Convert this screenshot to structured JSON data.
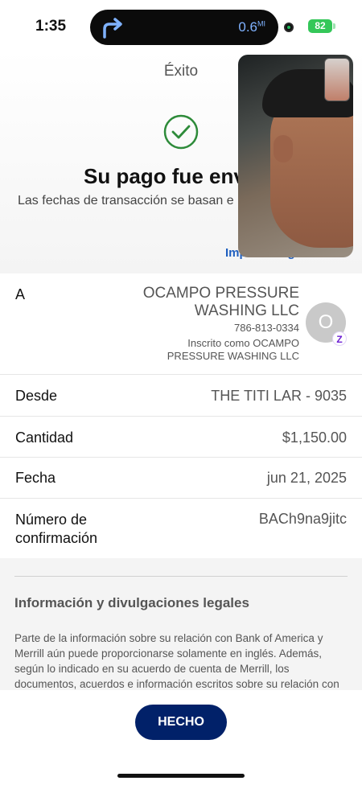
{
  "status_bar": {
    "time": "1:35",
    "nav_distance": "0.6",
    "nav_unit": "MI",
    "battery": "82"
  },
  "header": {
    "title": "Éxito",
    "success_title": "Su pago fue env",
    "success_subtitle": "Las fechas de transacción se basan e",
    "print_link": "Imprimir o guardar"
  },
  "recipient": {
    "label": "A",
    "name": "OCAMPO PRESSURE WASHING LLC",
    "phone": "786-813-0334",
    "registered_as": "Inscrito como OCAMPO PRESSURE WASHING LLC",
    "avatar_initial": "O",
    "badge": "Z"
  },
  "details": [
    {
      "label": "Desde",
      "value": "THE TITI LAR - 9035"
    },
    {
      "label": "Cantidad",
      "value": "$1,150.00"
    },
    {
      "label": "Fecha",
      "value": "jun 21, 2025"
    },
    {
      "label": "Número de confirmación",
      "value": "BACh9na9jitc"
    }
  ],
  "legal": {
    "title": "Información y divulgaciones legales",
    "text": "Parte de la información sobre su relación con Bank of America y Merrill aún puede proporcionarse solamente en inglés. Además, según lo indicado en su acuerdo de cuenta de Merrill, los documentos, acuerdos e información escritos sobre su relación con Merrill, que incluyen pero no se limitan a productos"
  },
  "footer": {
    "done_label": "HECHO"
  },
  "colors": {
    "primary_button": "#012169",
    "success_green": "#2e8b3a",
    "link_blue": "#1f5fbf"
  }
}
